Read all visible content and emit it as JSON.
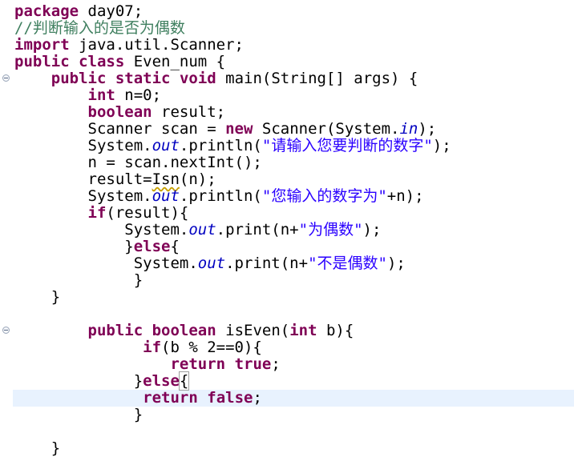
{
  "editor": {
    "lines": [
      {
        "tokens": [
          {
            "t": "kw",
            "v": "package"
          },
          {
            "t": "",
            "v": " day07;"
          }
        ]
      },
      {
        "tokens": [
          {
            "t": "cm",
            "v": "//判断输入的是否为偶数"
          }
        ]
      },
      {
        "tokens": [
          {
            "t": "kw",
            "v": "import"
          },
          {
            "t": "",
            "v": " java.util.Scanner;"
          }
        ]
      },
      {
        "tokens": [
          {
            "t": "kw",
            "v": "public"
          },
          {
            "t": "",
            "v": " "
          },
          {
            "t": "kw",
            "v": "class"
          },
          {
            "t": "",
            "v": " Even_num {"
          }
        ]
      },
      {
        "tokens": [
          {
            "t": "",
            "v": "    "
          },
          {
            "t": "kw",
            "v": "public"
          },
          {
            "t": "",
            "v": " "
          },
          {
            "t": "kw",
            "v": "static"
          },
          {
            "t": "",
            "v": " "
          },
          {
            "t": "kw",
            "v": "void"
          },
          {
            "t": "",
            "v": " main(String[] args) {"
          }
        ]
      },
      {
        "tokens": [
          {
            "t": "",
            "v": "        "
          },
          {
            "t": "kw",
            "v": "int"
          },
          {
            "t": "",
            "v": " n=0;"
          }
        ]
      },
      {
        "tokens": [
          {
            "t": "",
            "v": "        "
          },
          {
            "t": "kw",
            "v": "boolean"
          },
          {
            "t": "",
            "v": " result;"
          }
        ]
      },
      {
        "tokens": [
          {
            "t": "",
            "v": "        Scanner scan = "
          },
          {
            "t": "kw",
            "v": "new"
          },
          {
            "t": "",
            "v": " Scanner(System."
          },
          {
            "t": "fd",
            "v": "in"
          },
          {
            "t": "",
            "v": ");"
          }
        ]
      },
      {
        "tokens": [
          {
            "t": "",
            "v": "        System."
          },
          {
            "t": "fd",
            "v": "out"
          },
          {
            "t": "",
            "v": ".println("
          },
          {
            "t": "st",
            "v": "\"请输入您要判断的数字\""
          },
          {
            "t": "",
            "v": ");"
          }
        ]
      },
      {
        "tokens": [
          {
            "t": "",
            "v": "        n = scan.nextInt();"
          }
        ]
      },
      {
        "tokens": [
          {
            "t": "",
            "v": "        result="
          },
          {
            "t": "warn",
            "v": "Isn"
          },
          {
            "t": "",
            "v": "(n);"
          }
        ]
      },
      {
        "tokens": [
          {
            "t": "",
            "v": "        System."
          },
          {
            "t": "fd",
            "v": "out"
          },
          {
            "t": "",
            "v": ".println("
          },
          {
            "t": "st",
            "v": "\"您输入的数字为\""
          },
          {
            "t": "",
            "v": "+n);"
          }
        ]
      },
      {
        "tokens": [
          {
            "t": "",
            "v": "        "
          },
          {
            "t": "kw",
            "v": "if"
          },
          {
            "t": "",
            "v": "(result){"
          }
        ]
      },
      {
        "tokens": [
          {
            "t": "",
            "v": "            System."
          },
          {
            "t": "fd",
            "v": "out"
          },
          {
            "t": "",
            "v": ".print(n+"
          },
          {
            "t": "st",
            "v": "\"为偶数\""
          },
          {
            "t": "",
            "v": ");"
          }
        ]
      },
      {
        "tokens": [
          {
            "t": "",
            "v": "            }"
          },
          {
            "t": "kw",
            "v": "else"
          },
          {
            "t": "",
            "v": "{"
          }
        ]
      },
      {
        "tokens": [
          {
            "t": "",
            "v": "             System."
          },
          {
            "t": "fd",
            "v": "out"
          },
          {
            "t": "",
            "v": ".print(n+"
          },
          {
            "t": "st",
            "v": "\"不是偶数\""
          },
          {
            "t": "",
            "v": ");"
          }
        ]
      },
      {
        "tokens": [
          {
            "t": "",
            "v": "             }"
          }
        ]
      },
      {
        "tokens": [
          {
            "t": "",
            "v": "    }"
          }
        ]
      },
      {
        "tokens": []
      },
      {
        "tokens": [
          {
            "t": "",
            "v": "        "
          },
          {
            "t": "kw",
            "v": "public"
          },
          {
            "t": "",
            "v": " "
          },
          {
            "t": "kw",
            "v": "boolean"
          },
          {
            "t": "",
            "v": " isEven("
          },
          {
            "t": "kw",
            "v": "int"
          },
          {
            "t": "",
            "v": " b){"
          }
        ]
      },
      {
        "tokens": [
          {
            "t": "",
            "v": "              "
          },
          {
            "t": "kw",
            "v": "if"
          },
          {
            "t": "",
            "v": "(b % 2==0){"
          }
        ]
      },
      {
        "tokens": [
          {
            "t": "",
            "v": "                 "
          },
          {
            "t": "kw",
            "v": "return"
          },
          {
            "t": "",
            "v": " "
          },
          {
            "t": "kw",
            "v": "true"
          },
          {
            "t": "",
            "v": ";"
          }
        ]
      },
      {
        "tokens": [
          {
            "t": "",
            "v": "             }"
          },
          {
            "t": "kw",
            "v": "else"
          },
          {
            "t": "bx",
            "v": "{"
          }
        ]
      },
      {
        "tokens": [
          {
            "t": "",
            "v": "              "
          },
          {
            "t": "kw",
            "v": "return"
          },
          {
            "t": "",
            "v": " "
          },
          {
            "t": "kw",
            "v": "false"
          },
          {
            "t": "",
            "v": ";"
          }
        ]
      },
      {
        "tokens": [
          {
            "t": "",
            "v": "             }"
          }
        ]
      },
      {
        "tokens": []
      },
      {
        "tokens": [
          {
            "t": "",
            "v": "    }"
          }
        ]
      }
    ],
    "current_line_index": 23,
    "fold_markers": [
      4,
      19
    ],
    "colors": {
      "keyword": "#7f0055",
      "comment": "#3f7f5f",
      "string": "#2a00ff",
      "field": "#0000c0",
      "current_line": "#e8f2fe",
      "warning_underline": "#c8a000"
    }
  }
}
